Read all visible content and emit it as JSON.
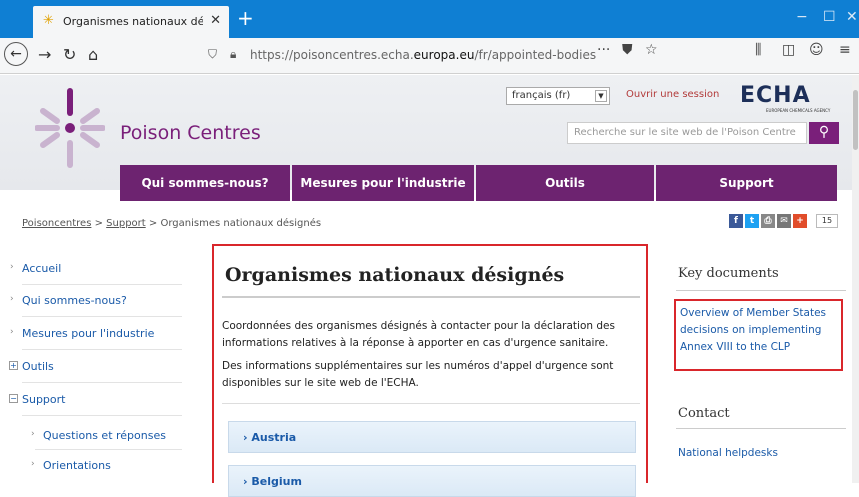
{
  "browser": {
    "tab_title": "Organismes nationaux désignés",
    "url_prefix": "https://poisoncentres.echa.",
    "url_domain": "europa.eu",
    "url_path": "/fr/appointed-bodies",
    "accent": "#0f7fd3"
  },
  "header": {
    "site_name": "Poison Centres",
    "language": "français (fr)",
    "login": "Ouvrir une session",
    "brand": "ECHA",
    "brand_sub": "EUROPEAN CHEMICALS AGENCY",
    "search_placeholder": "Recherche sur le site web de l'Poison Centre",
    "brand_color": "#6d2370"
  },
  "nav": [
    "Qui sommes-nous?",
    "Mesures pour l'industrie",
    "Outils",
    "Support"
  ],
  "breadcrumb": {
    "home": "Poisoncentres",
    "sep": ">",
    "support": "Support",
    "current": "Organismes nationaux désignés"
  },
  "share": {
    "count": "15"
  },
  "sidebar": [
    {
      "label": "Accueil",
      "marker": "›"
    },
    {
      "label": "Qui sommes-nous?",
      "marker": "›"
    },
    {
      "label": "Mesures pour l'industrie",
      "marker": "›"
    },
    {
      "label": "Outils",
      "marker": "+"
    },
    {
      "label": "Support",
      "marker": "−"
    },
    {
      "label": "Questions et réponses",
      "marker": "›"
    },
    {
      "label": "Orientations",
      "marker": "›"
    }
  ],
  "main": {
    "title": "Organismes nationaux désignés",
    "para1": "Coordonnées des organismes désignés à contacter pour la déclaration des informations relatives à la réponse à apporter en cas d'urgence sanitaire.",
    "para2": "Des informations supplémentaires sur les numéros d'appel d'urgence sont disponibles sur le site web de l'ECHA.",
    "accordion": [
      "Austria",
      "Belgium"
    ]
  },
  "right": {
    "key_documents": "Key documents",
    "key_link": "Overview of Member States decisions on implementing Annex VIII to the CLP",
    "contact": "Contact",
    "helpdesk": "National helpdesks"
  }
}
